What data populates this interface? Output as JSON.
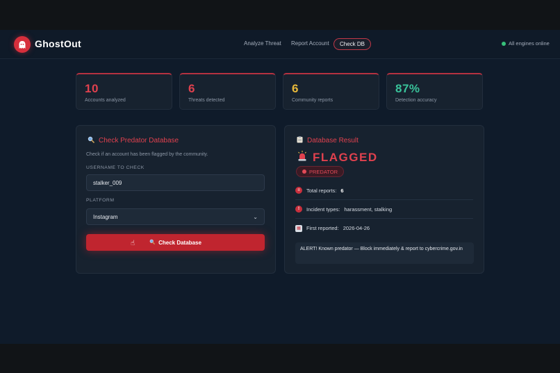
{
  "app": {
    "name": "GhostOut"
  },
  "nav": {
    "links": [
      "Analyze Threat",
      "Report Account",
      "Check DB"
    ],
    "active": "Check DB",
    "status": "All engines online"
  },
  "stats": [
    {
      "value": "10",
      "label": "Accounts analyzed",
      "color": "#e0414e"
    },
    {
      "value": "6",
      "label": "Threats detected",
      "color": "#e0414e"
    },
    {
      "value": "6",
      "label": "Community reports",
      "color": "#e8b93a"
    },
    {
      "value": "87%",
      "label": "Detection accuracy",
      "color": "#39c39a"
    }
  ],
  "check_panel": {
    "title": "Check Predator Database",
    "hint": "Check if an account has been flagged by the community.",
    "username_label": "USERNAME TO CHECK",
    "username_value": "stalker_009",
    "platform_label": "PLATFORM",
    "platform_value": "Instagram",
    "button_label": "Check Database"
  },
  "result_panel": {
    "title": "Database Result",
    "verdict": "FLAGGED",
    "badge": "PREDATOR",
    "total_reports_label": "Total reports:",
    "total_reports_value": "6",
    "incident_label": "Incident types:",
    "incident_value": "harassment, stalking",
    "first_reported_label": "First reported:",
    "first_reported_value": "2026-04-26",
    "alert": "ALERT! Known predator — Block immediately & report to cybercrime.gov.in"
  },
  "colors": {
    "accent": "#e0414e",
    "button": "#c0252f",
    "online": "#37c07a",
    "warning": "#e8b93a",
    "success": "#39c39a"
  }
}
